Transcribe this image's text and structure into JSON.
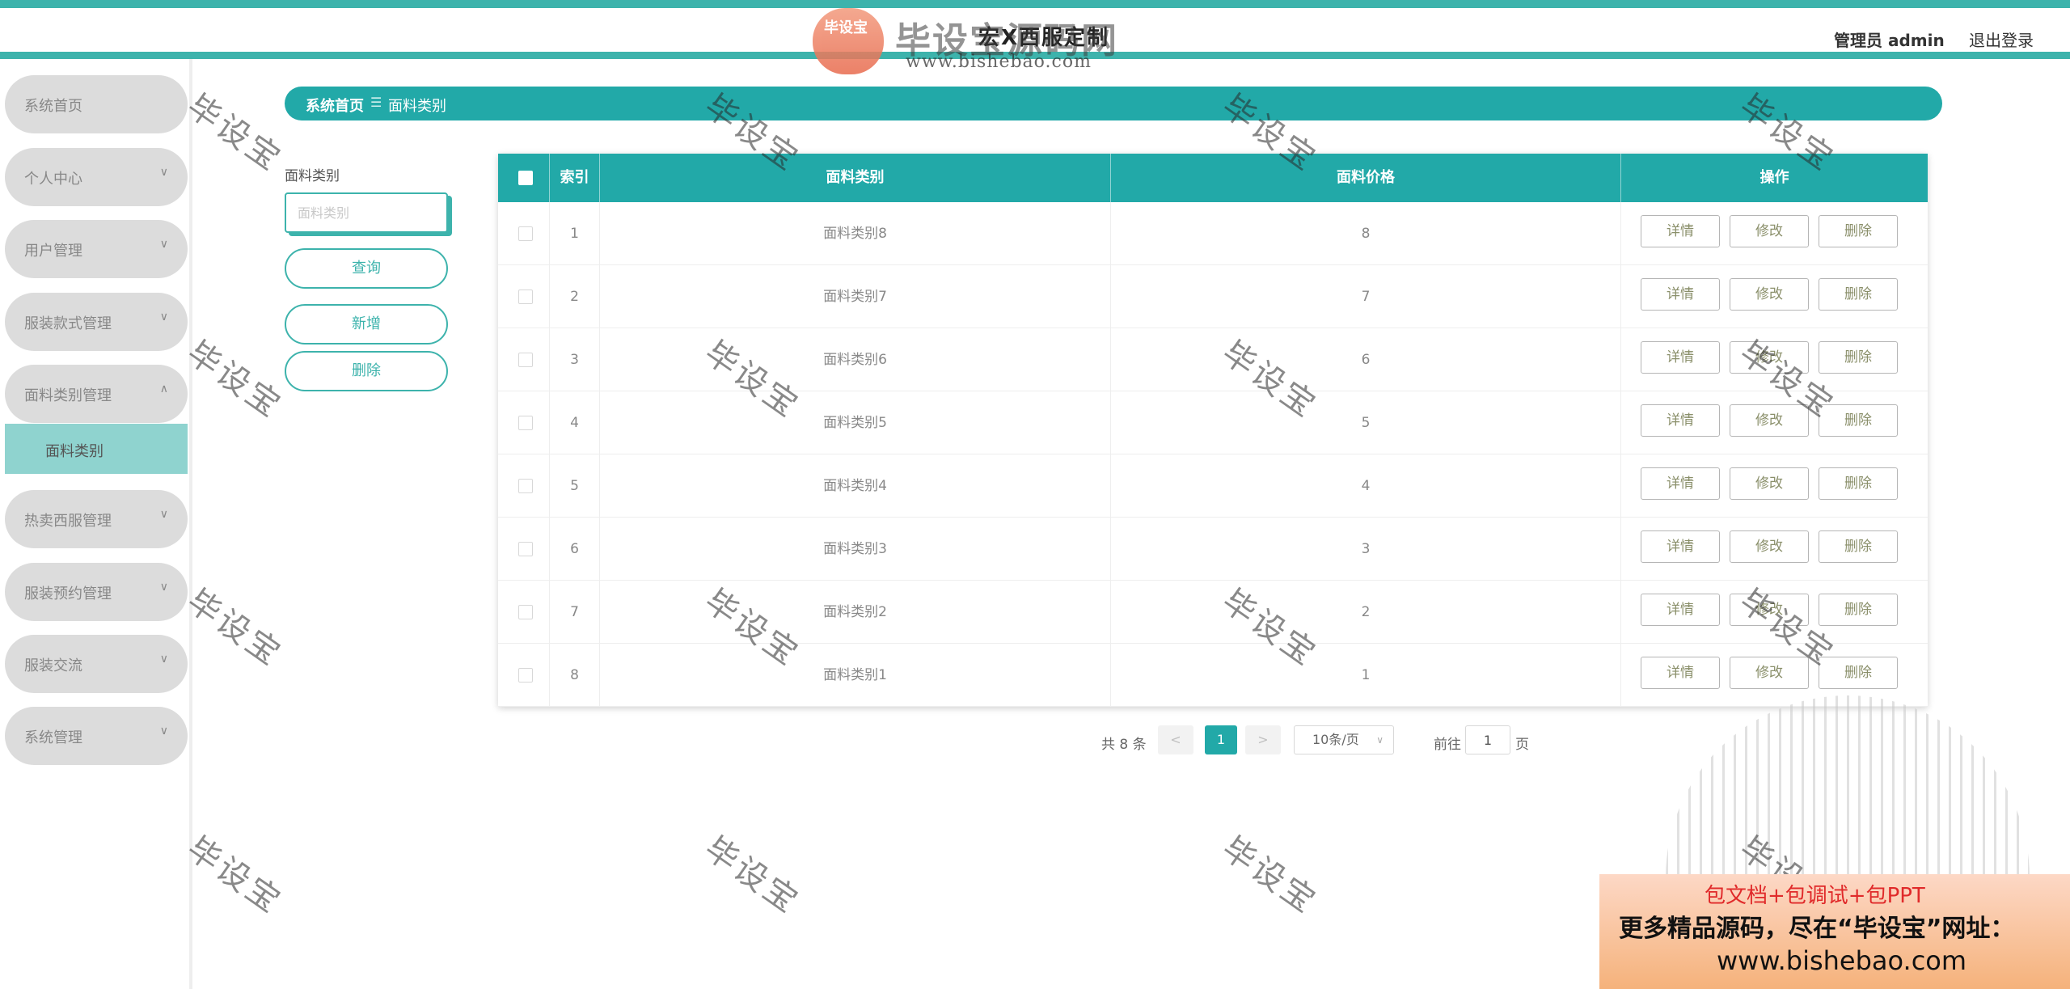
{
  "header": {
    "site_title": "宏X西服定制",
    "user_label": "管理员 admin",
    "logout_label": "退出登录"
  },
  "logo": {
    "badge_text": "毕设宝",
    "name": "毕设宝源码网",
    "url": "www.bishebao.com"
  },
  "sidebar": {
    "items": [
      {
        "label": "系统首页",
        "icon": "none"
      },
      {
        "label": "个人中心",
        "icon": "chevron-down-icon"
      },
      {
        "label": "用户管理",
        "icon": "chevron-down-icon"
      },
      {
        "label": "服装款式管理",
        "icon": "chevron-down-icon"
      },
      {
        "label": "面料类别管理",
        "icon": "chevron-up-icon"
      },
      {
        "label": "热卖西服管理",
        "icon": "chevron-down-icon"
      },
      {
        "label": "服装预约管理",
        "icon": "chevron-down-icon"
      },
      {
        "label": "服装交流",
        "icon": "chevron-down-icon"
      },
      {
        "label": "系统管理",
        "icon": "chevron-down-icon"
      }
    ],
    "submenu": {
      "label": "面料类别"
    }
  },
  "breadcrumb": {
    "home": "系统首页",
    "separator": "☰",
    "current": "面料类别"
  },
  "search": {
    "label": "面料类别",
    "placeholder": "面料类别",
    "value": "",
    "query_button": "查询",
    "add_button": "新增",
    "delete_button": "删除"
  },
  "table": {
    "columns": [
      "索引",
      "面料类别",
      "面料价格",
      "操作"
    ],
    "rows": [
      {
        "index": "1",
        "category": "面料类别8",
        "price": "8"
      },
      {
        "index": "2",
        "category": "面料类别7",
        "price": "7"
      },
      {
        "index": "3",
        "category": "面料类别6",
        "price": "6"
      },
      {
        "index": "4",
        "category": "面料类别5",
        "price": "5"
      },
      {
        "index": "5",
        "category": "面料类别4",
        "price": "4"
      },
      {
        "index": "6",
        "category": "面料类别3",
        "price": "3"
      },
      {
        "index": "7",
        "category": "面料类别2",
        "price": "2"
      },
      {
        "index": "8",
        "category": "面料类别1",
        "price": "1"
      }
    ],
    "actions": {
      "detail": "详情",
      "edit": "修改",
      "delete": "删除"
    }
  },
  "pagination": {
    "total": "共 8 条",
    "prev": "<",
    "current_page": "1",
    "next": ">",
    "page_size": "10条/页",
    "goto_label": "前往",
    "goto_value": "1",
    "page_suffix": "页"
  },
  "watermark": {
    "text": "毕设宝"
  },
  "promo": {
    "line1": "包文档+包调试+包PPT",
    "line2": "更多精品源码，尽在“毕设宝”网址：",
    "line3": "www.bishebao.com"
  },
  "colors": {
    "accent": "#22a9a8",
    "accent_light": "#8fd3cf",
    "sidebar_item": "#dcdcdc"
  }
}
